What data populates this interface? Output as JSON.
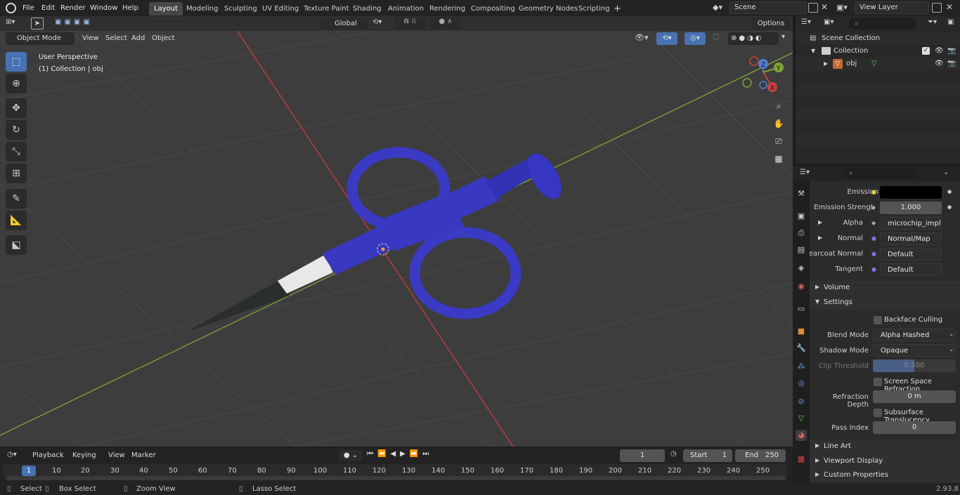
{
  "topbar": {
    "menus": [
      "File",
      "Edit",
      "Render",
      "Window",
      "Help"
    ],
    "workspaces": [
      "Layout",
      "Modeling",
      "Sculpting",
      "UV Editing",
      "Texture Paint",
      "Shading",
      "Animation",
      "Rendering",
      "Compositing",
      "Geometry Nodes",
      "Scripting"
    ],
    "active_workspace": "Layout",
    "add_tab": "+",
    "scene": "Scene",
    "view_layer": "View Layer"
  },
  "viewport_header": {
    "mode": "Object Mode",
    "menus": [
      "View",
      "Select",
      "Add",
      "Object"
    ],
    "orientation": "Global",
    "options": "Options"
  },
  "viewport": {
    "perspective": "User Perspective",
    "collection": "(1) Collection | obj",
    "axes": {
      "x": "X",
      "y": "Y",
      "z": "Z"
    },
    "colors": {
      "bg": "#3d3d3d",
      "x_axis": "#c4403f",
      "y_axis": "#7fa33a",
      "syringe": "#3838c0"
    }
  },
  "outliner": {
    "root": "Scene Collection",
    "collection": "Collection",
    "object": "obj"
  },
  "properties": {
    "rows": [
      {
        "label": "Emission",
        "value": ""
      },
      {
        "label": "Emission Strengt",
        "value": "1.000"
      },
      {
        "label": "Alpha",
        "value": "microchip_implant_..."
      },
      {
        "label": "Normal",
        "value": "Normal/Map"
      },
      {
        "label": "Clearcoat Normal",
        "value": "Default"
      },
      {
        "label": "Tangent",
        "value": "Default"
      }
    ],
    "sections": {
      "volume": "Volume",
      "settings": "Settings",
      "line_art": "Line Art",
      "viewport_display": "Viewport Display",
      "custom_properties": "Custom Properties"
    },
    "settings": {
      "backface_culling": "Backface Culling",
      "blend_mode_label": "Blend Mode",
      "blend_mode": "Alpha Hashed",
      "shadow_mode_label": "Shadow Mode",
      "shadow_mode": "Opaque",
      "clip_threshold_label": "Clip Threshold",
      "clip_threshold": "0.500",
      "ssr": "Screen Space Refraction",
      "refraction_depth_label": "Refraction Depth",
      "refraction_depth": "0 m",
      "subsurface": "Subsurface Translucency",
      "pass_index_label": "Pass Index",
      "pass_index": "0"
    }
  },
  "timeline": {
    "menus": [
      "Playback",
      "Keying",
      "View",
      "Marker"
    ],
    "current_frame": "1",
    "start_label": "Start",
    "start": "1",
    "end_label": "End",
    "end": "250",
    "ticks": [
      "1",
      "10",
      "20",
      "30",
      "40",
      "50",
      "60",
      "70",
      "80",
      "90",
      "100",
      "110",
      "120",
      "130",
      "140",
      "150",
      "160",
      "170",
      "180",
      "190",
      "200",
      "210",
      "220",
      "230",
      "240",
      "250"
    ]
  },
  "status": {
    "select": "Select",
    "box_select": "Box Select",
    "zoom_view": "Zoom View",
    "lasso_select": "Lasso Select",
    "version": "2.93.8"
  }
}
